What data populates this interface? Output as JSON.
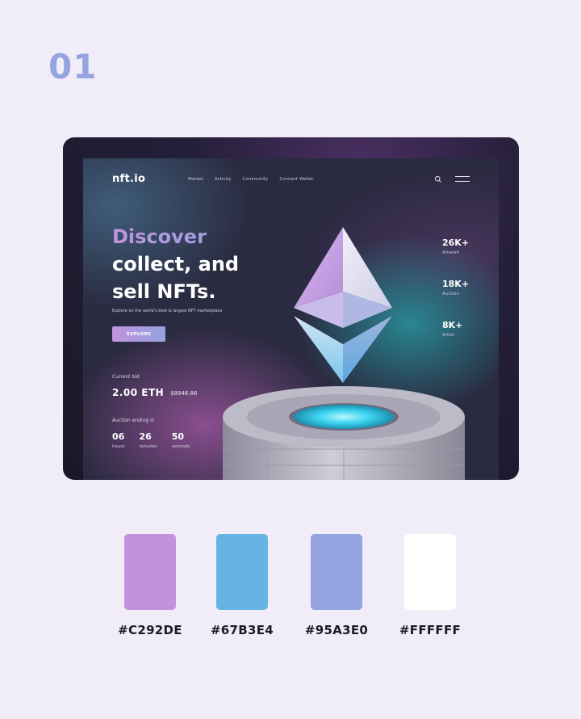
{
  "step": {
    "number": "01"
  },
  "site": {
    "logo": "nft.io",
    "nav": [
      "Market",
      "Activity",
      "Community",
      "Connect Wallet"
    ]
  },
  "hero": {
    "title_highlight": "Discover",
    "title_line2": "collect, and",
    "title_line3": "sell NFTs.",
    "subtitle": "Explore on the world's best & largest NFT marketplace",
    "cta_label": "EXPLORE"
  },
  "bid": {
    "label": "Current bid",
    "eth": "2.00 ETH",
    "usd": "$8946.86"
  },
  "auction": {
    "label": "Auction ending in",
    "countdown": [
      {
        "value": "06",
        "unit": "hours"
      },
      {
        "value": "26",
        "unit": "minutes"
      },
      {
        "value": "50",
        "unit": "seconds"
      }
    ]
  },
  "stats": [
    {
      "value": "26K+",
      "label": "Artwork"
    },
    {
      "value": "18K+",
      "label": "Auction"
    },
    {
      "value": "8K+",
      "label": "Artist"
    }
  ],
  "palette": [
    {
      "hex": "#C292DE",
      "color": "#c292de"
    },
    {
      "hex": "#67B3E4",
      "color": "#67b3e4"
    },
    {
      "hex": "#95A3E0",
      "color": "#95a3e0"
    },
    {
      "hex": "#FFFFFF",
      "color": "#ffffff"
    }
  ]
}
